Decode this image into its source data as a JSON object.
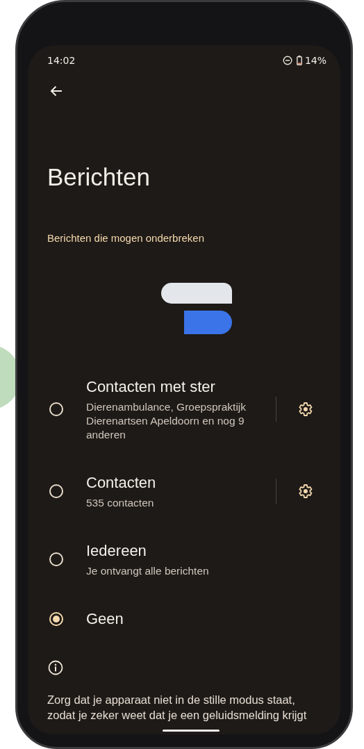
{
  "status_bar": {
    "time": "14:02",
    "battery": "14%"
  },
  "title": "Berichten",
  "subtitle": "Berichten die mogen onderbreken",
  "options": [
    {
      "title": "Contacten met ster",
      "subtitle": "Dierenambulance, Groepspraktijk Dierenartsen Apeldoorn en nog 9 anderen",
      "selected": false,
      "settings": true
    },
    {
      "title": "Contacten",
      "subtitle": "535 contacten",
      "selected": false,
      "settings": true
    },
    {
      "title": "Iedereen",
      "subtitle": "Je ontvangt alle berichten",
      "selected": false,
      "settings": false
    },
    {
      "title": "Geen",
      "selected": true,
      "settings": false
    }
  ],
  "info": "Zorg dat je apparaat niet in de stille modus staat, zodat je zeker weet dat je een geluidsmelding krijgt"
}
